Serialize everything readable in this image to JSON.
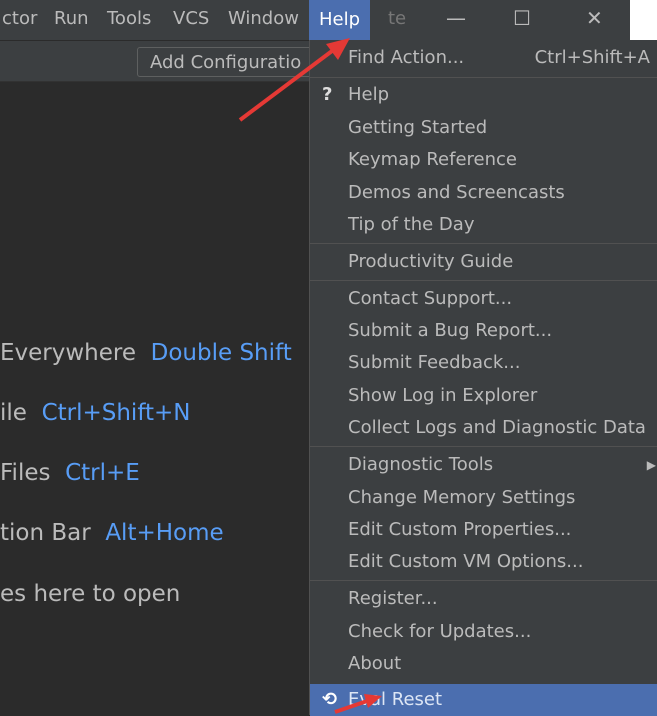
{
  "menubar": {
    "items": [
      "ctor",
      "Run",
      "Tools",
      "VCS",
      "Window",
      "Help",
      "te"
    ],
    "active": "Help"
  },
  "toolbar": {
    "add_configuration": "Add Configuratio"
  },
  "hints": [
    {
      "text": "Everywhere",
      "key": "Double Shift"
    },
    {
      "text": "ile",
      "key": "Ctrl+Shift+N"
    },
    {
      "text": "Files",
      "key": "Ctrl+E"
    },
    {
      "text": "tion Bar",
      "key": "Alt+Home"
    },
    {
      "text": "es here to open",
      "key": ""
    }
  ],
  "help_menu": {
    "items": [
      {
        "label": "Find Action...",
        "shortcut": "Ctrl+Shift+A"
      },
      {
        "label": "Help",
        "glyph": "?"
      },
      {
        "label": "Getting Started"
      },
      {
        "label": "Keymap Reference"
      },
      {
        "label": "Demos and Screencasts"
      },
      {
        "label": "Tip of the Day"
      },
      {
        "label": "Productivity Guide"
      },
      {
        "label": "Contact Support..."
      },
      {
        "label": "Submit a Bug Report..."
      },
      {
        "label": "Submit Feedback..."
      },
      {
        "label": "Show Log in Explorer"
      },
      {
        "label": "Collect Logs and Diagnostic Data"
      },
      {
        "label": "Diagnostic Tools"
      },
      {
        "label": "Change Memory Settings"
      },
      {
        "label": "Edit Custom Properties..."
      },
      {
        "label": "Edit Custom VM Options..."
      },
      {
        "label": "Register..."
      },
      {
        "label": "Check for Updates..."
      },
      {
        "label": "About"
      },
      {
        "label": "Eval Reset"
      }
    ]
  },
  "colors": {
    "accent": "#4b6eaf",
    "key_blue": "#589df6",
    "annotation_red": "#e53935"
  }
}
